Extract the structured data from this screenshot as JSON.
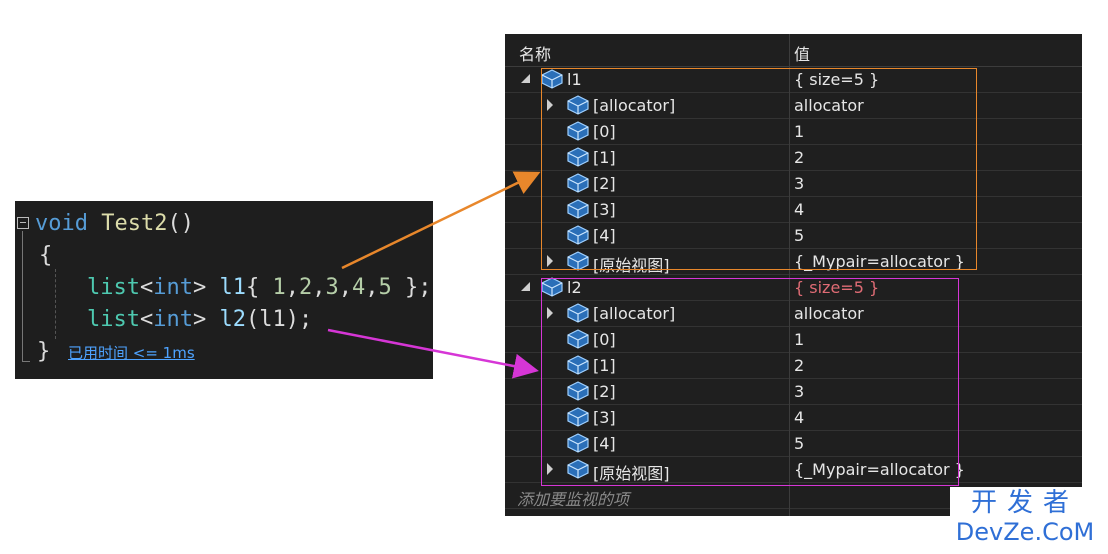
{
  "code": {
    "line1_keyword": "void",
    "line1_fn": "Test2",
    "line1_paren": "()",
    "line2": "{",
    "line3": {
      "type": "list",
      "lt": "<",
      "param": "int",
      "gt": ">",
      "var": "l1",
      "open": "{ ",
      "nums": [
        "1",
        "2",
        "3",
        "4",
        "5"
      ],
      "close": " };"
    },
    "line4": {
      "type": "list",
      "lt": "<",
      "param": "int",
      "gt": ">",
      "var": "l2",
      "arg": "(l1);"
    },
    "line5": "}",
    "elapsed_hint": "已用时间 <= 1ms"
  },
  "watch": {
    "col_name": "名称",
    "col_value": "值",
    "rows": [
      {
        "name": "l1",
        "value": "{ size=5 }"
      },
      {
        "name": "[allocator]",
        "value": "allocator"
      },
      {
        "name": "[0]",
        "value": "1"
      },
      {
        "name": "[1]",
        "value": "2"
      },
      {
        "name": "[2]",
        "value": "3"
      },
      {
        "name": "[3]",
        "value": "4"
      },
      {
        "name": "[4]",
        "value": "5"
      },
      {
        "name": "[原始视图]",
        "value": "{_Mypair=allocator }"
      },
      {
        "name": "l2",
        "value": "{ size=5 }"
      },
      {
        "name": "[allocator]",
        "value": "allocator"
      },
      {
        "name": "[0]",
        "value": "1"
      },
      {
        "name": "[1]",
        "value": "2"
      },
      {
        "name": "[2]",
        "value": "3"
      },
      {
        "name": "[3]",
        "value": "4"
      },
      {
        "name": "[4]",
        "value": "5"
      },
      {
        "name": "[原始视图]",
        "value": "{_Mypair=allocator }"
      }
    ],
    "add_watch_placeholder": "添加要监视的项"
  },
  "colors": {
    "highlight_l1": "#e8872b",
    "highlight_l2": "#d636d6",
    "changed_value": "#e06c75"
  },
  "watermark": {
    "cn": "开发者",
    "en": "DevZe.CoM"
  }
}
